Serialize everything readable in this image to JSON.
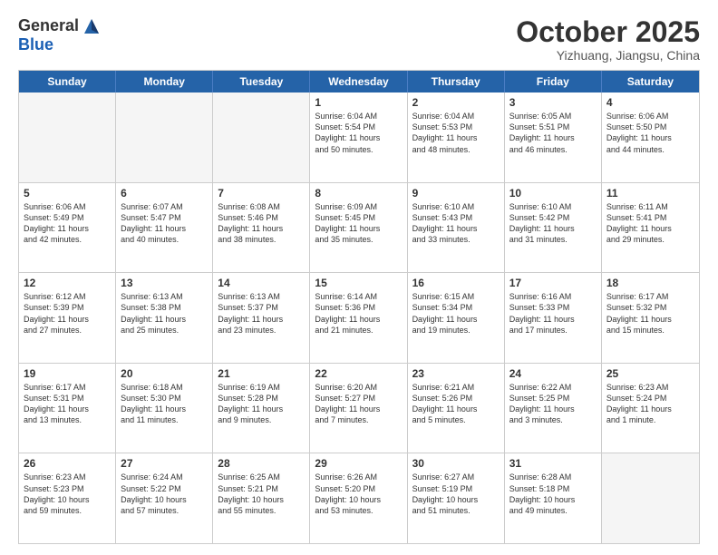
{
  "header": {
    "logo_general": "General",
    "logo_blue": "Blue",
    "month_title": "October 2025",
    "location": "Yizhuang, Jiangsu, China"
  },
  "weekdays": [
    "Sunday",
    "Monday",
    "Tuesday",
    "Wednesday",
    "Thursday",
    "Friday",
    "Saturday"
  ],
  "rows": [
    [
      {
        "day": "",
        "info": "",
        "empty": true
      },
      {
        "day": "",
        "info": "",
        "empty": true
      },
      {
        "day": "",
        "info": "",
        "empty": true
      },
      {
        "day": "1",
        "info": "Sunrise: 6:04 AM\nSunset: 5:54 PM\nDaylight: 11 hours\nand 50 minutes.",
        "empty": false
      },
      {
        "day": "2",
        "info": "Sunrise: 6:04 AM\nSunset: 5:53 PM\nDaylight: 11 hours\nand 48 minutes.",
        "empty": false
      },
      {
        "day": "3",
        "info": "Sunrise: 6:05 AM\nSunset: 5:51 PM\nDaylight: 11 hours\nand 46 minutes.",
        "empty": false
      },
      {
        "day": "4",
        "info": "Sunrise: 6:06 AM\nSunset: 5:50 PM\nDaylight: 11 hours\nand 44 minutes.",
        "empty": false
      }
    ],
    [
      {
        "day": "5",
        "info": "Sunrise: 6:06 AM\nSunset: 5:49 PM\nDaylight: 11 hours\nand 42 minutes.",
        "empty": false
      },
      {
        "day": "6",
        "info": "Sunrise: 6:07 AM\nSunset: 5:47 PM\nDaylight: 11 hours\nand 40 minutes.",
        "empty": false
      },
      {
        "day": "7",
        "info": "Sunrise: 6:08 AM\nSunset: 5:46 PM\nDaylight: 11 hours\nand 38 minutes.",
        "empty": false
      },
      {
        "day": "8",
        "info": "Sunrise: 6:09 AM\nSunset: 5:45 PM\nDaylight: 11 hours\nand 35 minutes.",
        "empty": false
      },
      {
        "day": "9",
        "info": "Sunrise: 6:10 AM\nSunset: 5:43 PM\nDaylight: 11 hours\nand 33 minutes.",
        "empty": false
      },
      {
        "day": "10",
        "info": "Sunrise: 6:10 AM\nSunset: 5:42 PM\nDaylight: 11 hours\nand 31 minutes.",
        "empty": false
      },
      {
        "day": "11",
        "info": "Sunrise: 6:11 AM\nSunset: 5:41 PM\nDaylight: 11 hours\nand 29 minutes.",
        "empty": false
      }
    ],
    [
      {
        "day": "12",
        "info": "Sunrise: 6:12 AM\nSunset: 5:39 PM\nDaylight: 11 hours\nand 27 minutes.",
        "empty": false
      },
      {
        "day": "13",
        "info": "Sunrise: 6:13 AM\nSunset: 5:38 PM\nDaylight: 11 hours\nand 25 minutes.",
        "empty": false
      },
      {
        "day": "14",
        "info": "Sunrise: 6:13 AM\nSunset: 5:37 PM\nDaylight: 11 hours\nand 23 minutes.",
        "empty": false
      },
      {
        "day": "15",
        "info": "Sunrise: 6:14 AM\nSunset: 5:36 PM\nDaylight: 11 hours\nand 21 minutes.",
        "empty": false
      },
      {
        "day": "16",
        "info": "Sunrise: 6:15 AM\nSunset: 5:34 PM\nDaylight: 11 hours\nand 19 minutes.",
        "empty": false
      },
      {
        "day": "17",
        "info": "Sunrise: 6:16 AM\nSunset: 5:33 PM\nDaylight: 11 hours\nand 17 minutes.",
        "empty": false
      },
      {
        "day": "18",
        "info": "Sunrise: 6:17 AM\nSunset: 5:32 PM\nDaylight: 11 hours\nand 15 minutes.",
        "empty": false
      }
    ],
    [
      {
        "day": "19",
        "info": "Sunrise: 6:17 AM\nSunset: 5:31 PM\nDaylight: 11 hours\nand 13 minutes.",
        "empty": false
      },
      {
        "day": "20",
        "info": "Sunrise: 6:18 AM\nSunset: 5:30 PM\nDaylight: 11 hours\nand 11 minutes.",
        "empty": false
      },
      {
        "day": "21",
        "info": "Sunrise: 6:19 AM\nSunset: 5:28 PM\nDaylight: 11 hours\nand 9 minutes.",
        "empty": false
      },
      {
        "day": "22",
        "info": "Sunrise: 6:20 AM\nSunset: 5:27 PM\nDaylight: 11 hours\nand 7 minutes.",
        "empty": false
      },
      {
        "day": "23",
        "info": "Sunrise: 6:21 AM\nSunset: 5:26 PM\nDaylight: 11 hours\nand 5 minutes.",
        "empty": false
      },
      {
        "day": "24",
        "info": "Sunrise: 6:22 AM\nSunset: 5:25 PM\nDaylight: 11 hours\nand 3 minutes.",
        "empty": false
      },
      {
        "day": "25",
        "info": "Sunrise: 6:23 AM\nSunset: 5:24 PM\nDaylight: 11 hours\nand 1 minute.",
        "empty": false
      }
    ],
    [
      {
        "day": "26",
        "info": "Sunrise: 6:23 AM\nSunset: 5:23 PM\nDaylight: 10 hours\nand 59 minutes.",
        "empty": false
      },
      {
        "day": "27",
        "info": "Sunrise: 6:24 AM\nSunset: 5:22 PM\nDaylight: 10 hours\nand 57 minutes.",
        "empty": false
      },
      {
        "day": "28",
        "info": "Sunrise: 6:25 AM\nSunset: 5:21 PM\nDaylight: 10 hours\nand 55 minutes.",
        "empty": false
      },
      {
        "day": "29",
        "info": "Sunrise: 6:26 AM\nSunset: 5:20 PM\nDaylight: 10 hours\nand 53 minutes.",
        "empty": false
      },
      {
        "day": "30",
        "info": "Sunrise: 6:27 AM\nSunset: 5:19 PM\nDaylight: 10 hours\nand 51 minutes.",
        "empty": false
      },
      {
        "day": "31",
        "info": "Sunrise: 6:28 AM\nSunset: 5:18 PM\nDaylight: 10 hours\nand 49 minutes.",
        "empty": false
      },
      {
        "day": "",
        "info": "",
        "empty": true
      }
    ]
  ]
}
